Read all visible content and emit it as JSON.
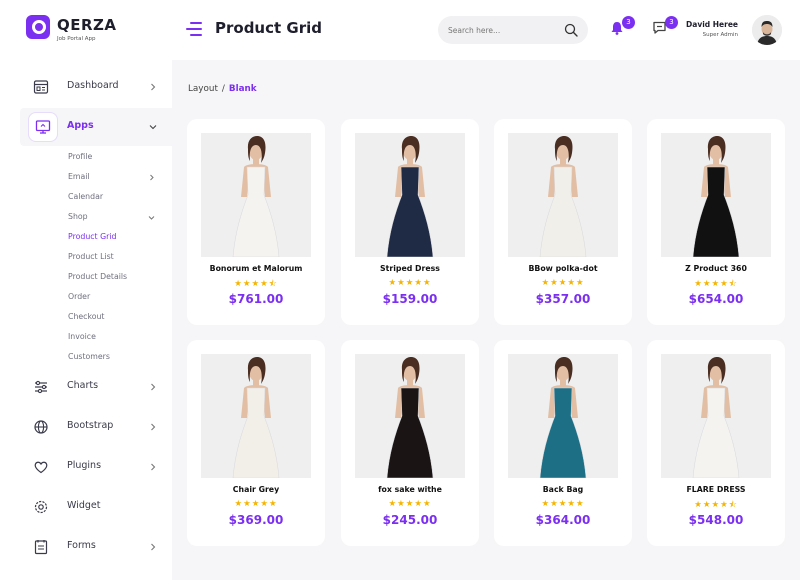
{
  "app": {
    "name": "QERZA",
    "tagline": "Job Portal App"
  },
  "header": {
    "title": "Product Grid",
    "search_placeholder": "Search here...",
    "notifications_count": "3",
    "messages_count": "3",
    "user_name": "David Heree",
    "user_role": "Super Admin"
  },
  "sidebar": {
    "items": [
      {
        "label": "Dashboard",
        "icon": "dashboard-icon"
      },
      {
        "label": "Apps",
        "icon": "monitor-icon"
      },
      {
        "label": "Charts",
        "icon": "sliders-icon"
      },
      {
        "label": "Bootstrap",
        "icon": "globe-icon"
      },
      {
        "label": "Plugins",
        "icon": "heart-icon"
      },
      {
        "label": "Widget",
        "icon": "settings-icon"
      },
      {
        "label": "Forms",
        "icon": "forms-icon"
      }
    ],
    "apps_submenu": [
      "Profile",
      "Email",
      "Calendar",
      "Shop",
      "Product Grid",
      "Product List",
      "Product Details",
      "Order",
      "Checkout",
      "Invoice",
      "Customers"
    ],
    "active_submenu": "Product Grid"
  },
  "breadcrumb": {
    "parent": "Layout",
    "separator": "/",
    "current": "Blank"
  },
  "products": [
    {
      "name": "Bonorum et Malorum",
      "price": "$761.00",
      "rating": 4.5,
      "dress_color": "#f4f3f0"
    },
    {
      "name": "Striped Dress",
      "price": "$159.00",
      "rating": 5,
      "dress_color": "#1f2a44"
    },
    {
      "name": "BBow polka-dot",
      "price": "$357.00",
      "rating": 5,
      "dress_color": "#f1efea"
    },
    {
      "name": "Z Product 360",
      "price": "$654.00",
      "rating": 4.5,
      "dress_color": "#111111"
    },
    {
      "name": "Chair Grey",
      "price": "$369.00",
      "rating": 5,
      "dress_color": "#f2efe9"
    },
    {
      "name": "fox sake withe",
      "price": "$245.00",
      "rating": 5,
      "dress_color": "#1a1414"
    },
    {
      "name": "Back Bag",
      "price": "$364.00",
      "rating": 5,
      "dress_color": "#1d6f86"
    },
    {
      "name": "FLARE DRESS",
      "price": "$548.00",
      "rating": 4.5,
      "dress_color": "#f4f3f0"
    }
  ],
  "colors": {
    "accent": "#7b2ff0",
    "star": "#f5b400",
    "background": "#f6f6f8"
  }
}
